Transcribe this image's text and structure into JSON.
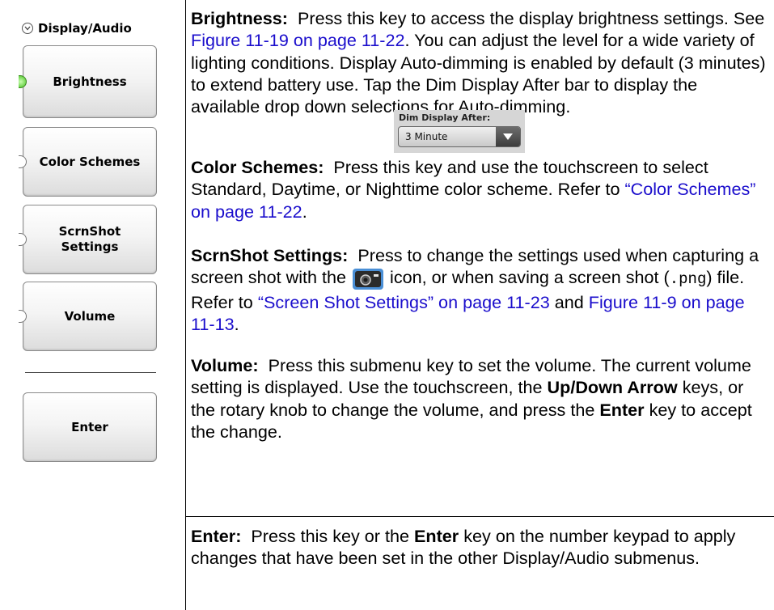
{
  "menu": {
    "title": "Display/Audio",
    "keys": [
      {
        "label": "Brightness",
        "active": true
      },
      {
        "label": "Color Schemes",
        "active": false
      },
      {
        "label": "ScrnShot Settings",
        "active": false
      },
      {
        "label": "Volume",
        "active": false
      }
    ],
    "enter_label": "Enter"
  },
  "descriptions": {
    "brightness": {
      "term": "Brightness:",
      "text1": "Press this key to access the display brightness settings. See",
      "link1": "Figure 11-19 on page 11-22",
      "text2": ". You can adjust the level for a wide variety of lighting conditions. Display Auto-dimming is enabled by default (3 minutes) to extend battery use. Tap the Dim Display After bar to display the available drop down selections for Auto-dimming."
    },
    "dim_widget": {
      "label": "Dim Display After:",
      "value": "3 Minute"
    },
    "color_schemes": {
      "term": "Color Schemes:",
      "text1": "Press this key and use the touchscreen to select Standard, Daytime, or Nighttime color scheme. Refer to",
      "link1": "“Color Schemes” on page 11-22",
      "text2": "."
    },
    "scrnshot": {
      "term": "ScrnShot Settings:",
      "text1": "Press to change the settings used when capturing a screen shot with the",
      "text2": "icon, or when saving a screen shot (",
      "code": ".png",
      "text3": ") file. Refer to",
      "link1": "“Screen Shot Settings” on page 11-23",
      "text4": "and",
      "link2": "Figure 11-9 on page 11-13",
      "text5": "."
    },
    "volume": {
      "term": "Volume:",
      "text1": "Press this submenu key to set the volume. The current volume setting is displayed. Use the touchscreen, the",
      "bold1": "Up/Down Arrow",
      "text2": "keys, or the rotary knob to change the volume, and press the",
      "bold2": "Enter",
      "text3": "key to accept the change."
    },
    "enter": {
      "term": "Enter:",
      "text1": "Press this key or the",
      "bold1": "Enter",
      "text2": "key on the number keypad to apply changes that have been set in the other Display/Audio submenus."
    }
  },
  "colors": {
    "link": "#1a0dcc",
    "led_on": "#46c020"
  }
}
